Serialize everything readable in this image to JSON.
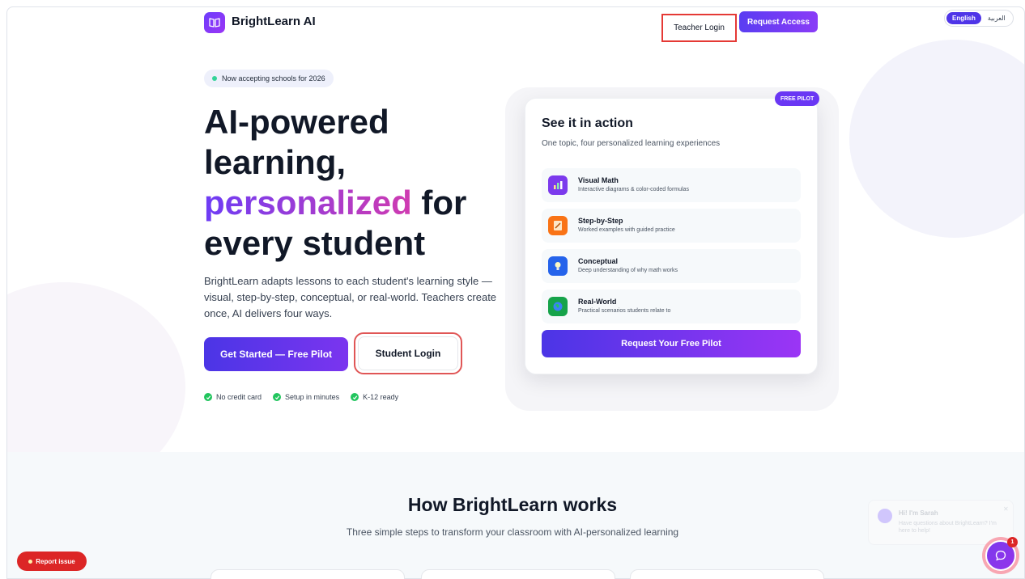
{
  "header": {
    "brand": "BrightLearn AI",
    "teacher_login": "Teacher Login",
    "request_access": "Request Access",
    "lang_en": "English",
    "lang_ar": "العربية"
  },
  "hero": {
    "badge": "Now accepting schools for 2026",
    "title_line1": "AI-powered",
    "title_line2": "learning,",
    "title_highlight": "personalized",
    "title_for": " for",
    "title_line4": "every student",
    "description": "BrightLearn adapts lessons to each student's learning style — visual, step-by-step, conceptual, or real-world. Teachers create once, AI delivers four ways.",
    "primary_cta": "Get Started — Free Pilot",
    "student_login": "Student Login",
    "checks": [
      "No credit card",
      "Setup in minutes",
      "K-12 ready"
    ]
  },
  "card": {
    "badge": "FREE PILOT",
    "title": "See it in action",
    "subtitle": "One topic, four personalized learning experiences",
    "modes": [
      {
        "name": "Visual Math",
        "desc": "Interactive diagrams & color-coded formulas",
        "icon": "chart-icon",
        "color": "#7c3aed"
      },
      {
        "name": "Step-by-Step",
        "desc": "Worked examples with guided practice",
        "icon": "memo-icon",
        "color": "#f97316"
      },
      {
        "name": "Conceptual",
        "desc": "Deep understanding of why math works",
        "icon": "lightbulb-icon",
        "color": "#2563eb"
      },
      {
        "name": "Real-World",
        "desc": "Practical scenarios students relate to",
        "icon": "globe-icon",
        "color": "#16a34a"
      }
    ],
    "cta": "Request Your Free Pilot"
  },
  "how": {
    "title": "How BrightLearn works",
    "subtitle": "Three simple steps to transform your classroom with AI-personalized learning"
  },
  "widgets": {
    "report_issue": "Report issue",
    "chat_name": "Hi! I'm Sarah",
    "chat_message": "Have questions about BrightLearn? I'm here to help!",
    "chat_count": "1"
  },
  "colors": {
    "accent": "#5b3cf0",
    "gradient_text_start": "#6d3cf6",
    "gradient_text_end": "#d03bb0",
    "report": "#dc2626",
    "check": "#22c55e"
  }
}
